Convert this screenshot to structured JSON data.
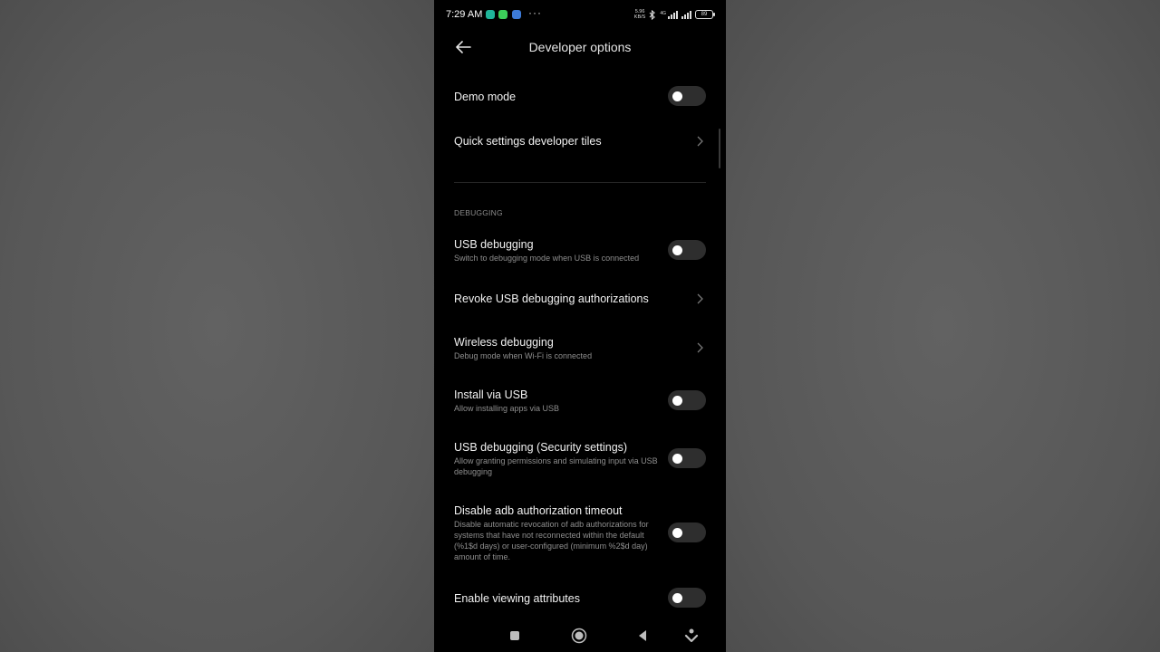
{
  "status_bar": {
    "time": "7:29 AM",
    "net_speed_value": "5.96",
    "net_speed_unit": "KB/S",
    "network_type": "4G",
    "battery": "89",
    "more": "···"
  },
  "header": {
    "title": "Developer options"
  },
  "top_rows": [
    {
      "label": "Demo mode",
      "type": "toggle",
      "on": false
    },
    {
      "label": "Quick settings developer tiles",
      "type": "link"
    }
  ],
  "debugging": {
    "section_title": "DEBUGGING",
    "rows": [
      {
        "label": "USB debugging",
        "sub": "Switch to debugging mode when USB is connected",
        "type": "toggle",
        "on": false
      },
      {
        "label": "Revoke USB debugging authorizations",
        "type": "link"
      },
      {
        "label": "Wireless debugging",
        "sub": "Debug mode when Wi-Fi is connected",
        "type": "link"
      },
      {
        "label": "Install via USB",
        "sub": "Allow installing apps via USB",
        "type": "toggle",
        "on": false
      },
      {
        "label": "USB debugging (Security settings)",
        "sub": "Allow granting permissions and simulating input via USB debugging",
        "type": "toggle",
        "on": false
      },
      {
        "label": "Disable adb authorization timeout",
        "sub": "Disable automatic revocation of adb authorizations for systems that have not reconnected within the default (%1$d days) or user-configured (minimum %2$d day) amount of time.",
        "type": "toggle",
        "on": false
      },
      {
        "label": "Enable viewing attributes",
        "type": "toggle",
        "on": false
      }
    ]
  },
  "colors": {
    "background": "#000000",
    "toggle_off": "#2e2e2e",
    "subtext": "#8e8e8e"
  }
}
